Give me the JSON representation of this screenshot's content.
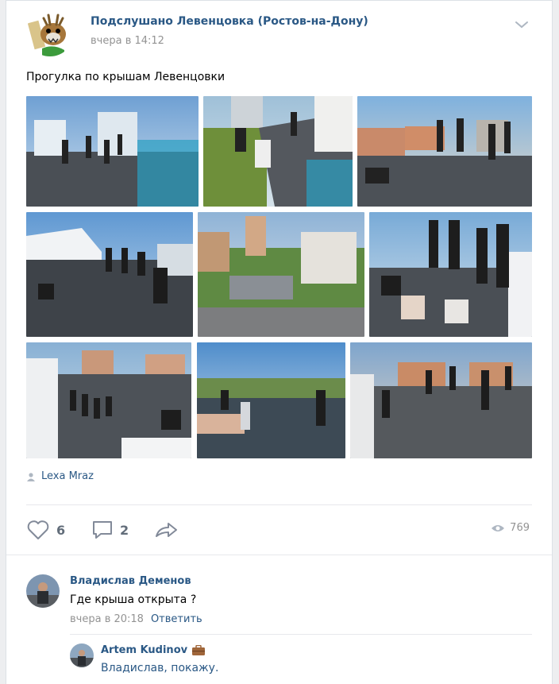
{
  "post": {
    "group_name": "Подслушано Левенцовка (Ростов-на-Дону)",
    "time": "вчера в 14:12",
    "text": "Прогулка по крышам Левенцовки",
    "author": "Lexa Mraz",
    "likes": "6",
    "comments": "2",
    "views": "769"
  },
  "comments": [
    {
      "name": "Владислав Деменов",
      "text": "Где крыша открыта ?",
      "time": "вчера в 20:18",
      "reply_label": "Ответить"
    },
    {
      "name": "Artem Kudinov",
      "text": "Владислав, покажу."
    }
  ],
  "colors": {
    "link": "#2a5885",
    "meta": "#939393",
    "icon": "#828a99"
  },
  "icons": [
    "chevron-down-icon",
    "person-icon",
    "heart-icon",
    "comment-icon",
    "share-icon",
    "eye-icon",
    "briefcase-icon"
  ]
}
